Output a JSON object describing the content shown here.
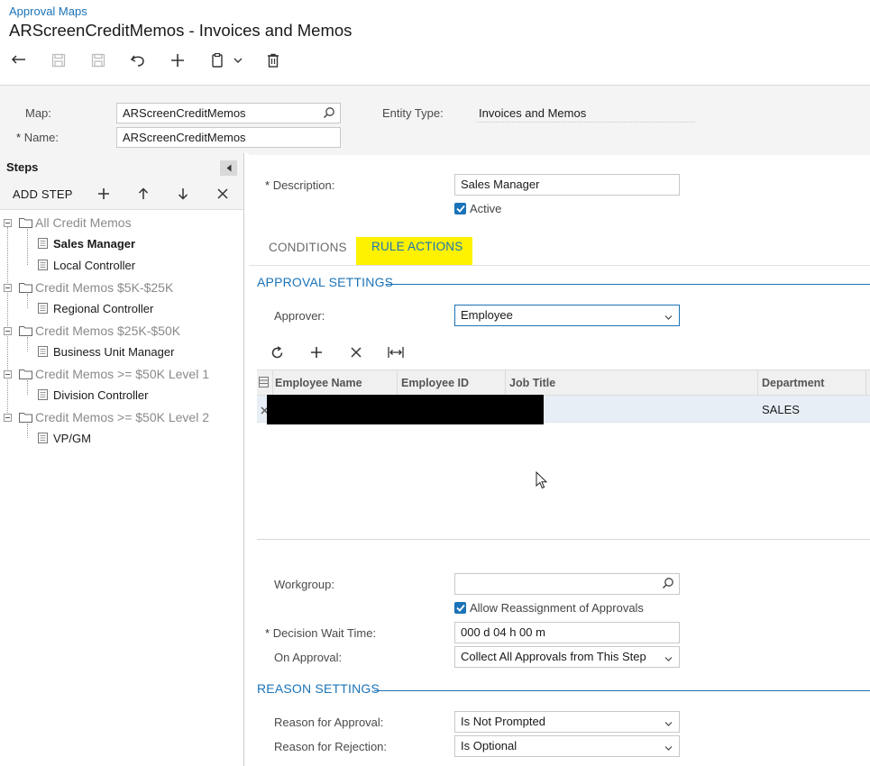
{
  "breadcrumb": "Approval Maps",
  "title": "ARScreenCreditMemos - Invoices and Memos",
  "toolbar": {
    "icons": [
      "undo-arrow-icon",
      "save-close-icon",
      "save-icon",
      "cancel-icon",
      "add-icon",
      "copy-paste-icon",
      "chevron-down-icon",
      "delete-icon"
    ]
  },
  "header": {
    "map_label": "Map:",
    "map_value": "ARScreenCreditMemos",
    "name_label": "Name:",
    "name_value": "ARScreenCreditMemos",
    "required_mark": "*",
    "entity_type_label": "Entity Type:",
    "entity_type_value": "Invoices and Memos"
  },
  "steps_panel": {
    "title": "Steps",
    "add_step": "ADD STEP",
    "tree": [
      {
        "group": "All Credit Memos",
        "items": [
          {
            "label": "Sales Manager",
            "selected": true
          },
          {
            "label": "Local Controller",
            "selected": false
          }
        ]
      },
      {
        "group": "Credit Memos $5K-$25K",
        "items": [
          {
            "label": "Regional Controller",
            "selected": false
          }
        ]
      },
      {
        "group": "Credit Memos $25K-$50K",
        "items": [
          {
            "label": "Business Unit Manager",
            "selected": false
          }
        ]
      },
      {
        "group": "Credit Memos >= $50K Level 1",
        "items": [
          {
            "label": "Division Controller",
            "selected": false
          }
        ]
      },
      {
        "group": "Credit Memos >= $50K Level 2",
        "items": [
          {
            "label": "VP/GM",
            "selected": false
          }
        ]
      }
    ]
  },
  "step_form": {
    "description_label": "Description:",
    "description_value": "Sales Manager",
    "active_label": "Active",
    "active_checked": true
  },
  "tabs": [
    {
      "label": "CONDITIONS",
      "active": false
    },
    {
      "label": "RULE ACTIONS",
      "active": true
    }
  ],
  "approval_settings": {
    "heading": "APPROVAL SETTINGS",
    "approver_label": "Approver:",
    "approver_value": "Employee",
    "grid": {
      "columns": [
        "Employee Name",
        "Employee ID",
        "Job Title",
        "Department"
      ],
      "rows": [
        {
          "employee_name": "",
          "employee_id": "",
          "job_title": "",
          "department": "SALES"
        }
      ]
    },
    "workgroup_label": "Workgroup:",
    "workgroup_value": "",
    "allow_reassignment_label": "Allow Reassignment of Approvals",
    "allow_reassignment_checked": true,
    "decision_wait_label": "Decision Wait Time:",
    "decision_wait_value": "000 d 04 h 00 m",
    "on_approval_label": "On Approval:",
    "on_approval_value": "Collect All Approvals from This Step"
  },
  "reason_settings": {
    "heading": "REASON SETTINGS",
    "reason_approval_label": "Reason for Approval:",
    "reason_approval_value": "Is Not Prompted",
    "reason_rejection_label": "Reason for Rejection:",
    "reason_rejection_value": "Is Optional"
  },
  "colors": {
    "accent": "#1a73b8",
    "highlight": "#fff200",
    "selected_row": "#e7eef6"
  }
}
